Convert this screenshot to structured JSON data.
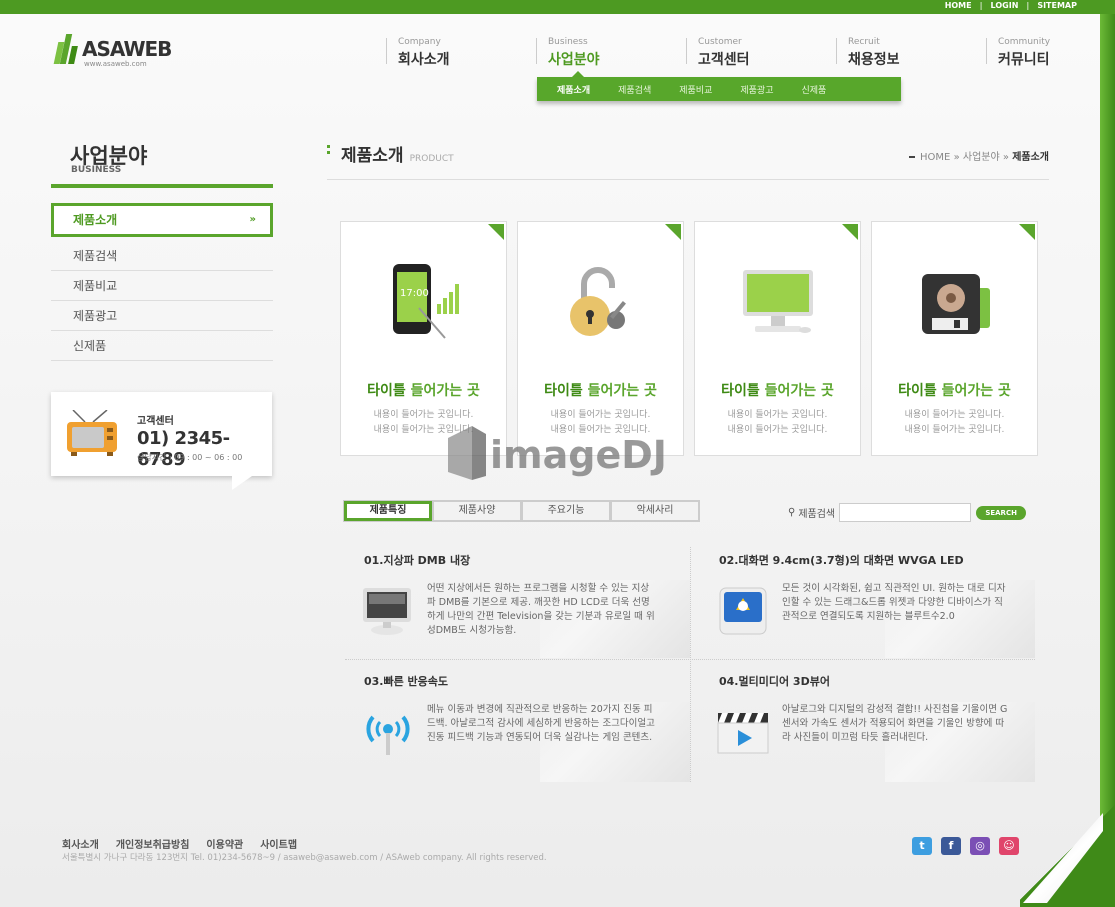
{
  "top_links": [
    "HOME",
    "LOGIN",
    "SITEMAP"
  ],
  "logo": {
    "name": "ASAWEB",
    "url": "www.asaweb.com"
  },
  "gnb": [
    {
      "en": "Company",
      "ko": "회사소개"
    },
    {
      "en": "Business",
      "ko": "사업분야"
    },
    {
      "en": "Customer",
      "ko": "고객센터"
    },
    {
      "en": "Recruit",
      "ko": "채용정보"
    },
    {
      "en": "Community",
      "ko": "커뮤니티"
    }
  ],
  "subnav": [
    "제품소개",
    "제품검색",
    "제품비교",
    "제품광고",
    "신제품"
  ],
  "lnb": {
    "title": "사업분야",
    "title_en": "BUSINESS",
    "items": [
      "제품소개",
      "제품검색",
      "제품비교",
      "제품광고",
      "신제품"
    ]
  },
  "customer_center": {
    "label": "고객센터",
    "phone": "01) 2345-6789",
    "hours": "상담시간 : 09 : 00 ~ 06 : 00"
  },
  "content": {
    "title": "제품소개",
    "title_en": "PRODUCT",
    "breadcrumb": {
      "home": "HOME",
      "mid": "사업분야",
      "current": "제품소개",
      "sep": "»"
    }
  },
  "cards": [
    {
      "title_a": "타이틀",
      "title_b": " 들어가는 곳",
      "line1": "내용이 들어가는 곳입니다.",
      "line2": "내용이 들어가는 곳입니다."
    },
    {
      "title_a": "타이틀",
      "title_b": " 들어가는 곳",
      "line1": "내용이 들어가는 곳입니다.",
      "line2": "내용이 들어가는 곳입니다."
    },
    {
      "title_a": "타이틀",
      "title_b": " 들어가는 곳",
      "line1": "내용이 들어가는 곳입니다.",
      "line2": "내용이 들어가는 곳입니다."
    },
    {
      "title_a": "타이틀",
      "title_b": " 들어가는 곳",
      "line1": "내용이 들어가는 곳입니다.",
      "line2": "내용이 들어가는 곳입니다."
    }
  ],
  "watermark": "imageDJ",
  "tabs": [
    "제품특징",
    "제품사양",
    "주요기능",
    "악세사리"
  ],
  "product_search": {
    "label": "제품검색",
    "button": "SEARCH",
    "placeholder": ""
  },
  "features": [
    {
      "title": "01.지상파 DMB 내장",
      "text": "어떤 지상에서든 원하는 프로그램을 시청할 수 있는 지상파 DMB를 기본으로 제공. 깨끗한 HD LCD로 더욱 선명하게 나만의 간편 Television을 갖는 기분과 유로일 때 위성DMB도 시청가능함."
    },
    {
      "title": "02.대화면 9.4cm(3.7형)의 대화면 WVGA LED",
      "text": "모든 것이 시각화된, 쉽고 직관적인 UI. 원하는 대로 디자인할 수 있는 드래그&드롭 위젯과 다양한 디바이스가 직관적으로 연결되도록 지원하는 블루트수2.0"
    },
    {
      "title": "03.빠른 반응속도",
      "text": "메뉴 이동과 변경에 직관적으로 반응하는 20가지 진동 피드백. 아날로그적 감사에 세심하게 반응하는 조그다이얼고 진동 피드백 기능과 연동되어 더욱 실감나는 게임 콘텐츠."
    },
    {
      "title": "04.멀티미디어 3D뷰어",
      "text": "아날로그와 디지털의 감성적 결합!! 사진첩을 기울이면 G센서와 가속도 센서가 적용되어 화면을 기울인 방향에 따라 사진들이 미끄럼 타듯 흘러내린다."
    }
  ],
  "footer": {
    "links": [
      "회사소개",
      "개인정보취급방침",
      "이용약관",
      "사이트맵"
    ],
    "address": "서울특별시 가나구 다라동 123번지    Tel. 01)234-5678~9 / asaweb@asaweb.com / ASAweb company. All rights reserved."
  },
  "social": [
    {
      "icon": "twitter-icon",
      "glyph": "t",
      "color": "#3d9ee0"
    },
    {
      "icon": "facebook-icon",
      "glyph": "f",
      "color": "#3b5998"
    },
    {
      "icon": "messenger-icon",
      "glyph": "◎",
      "color": "#7b4fb5"
    },
    {
      "icon": "blog-icon",
      "glyph": "☺",
      "color": "#e0456b"
    }
  ],
  "colors": {
    "accent": "#5aa52c",
    "accent_dark": "#3e8a14"
  }
}
